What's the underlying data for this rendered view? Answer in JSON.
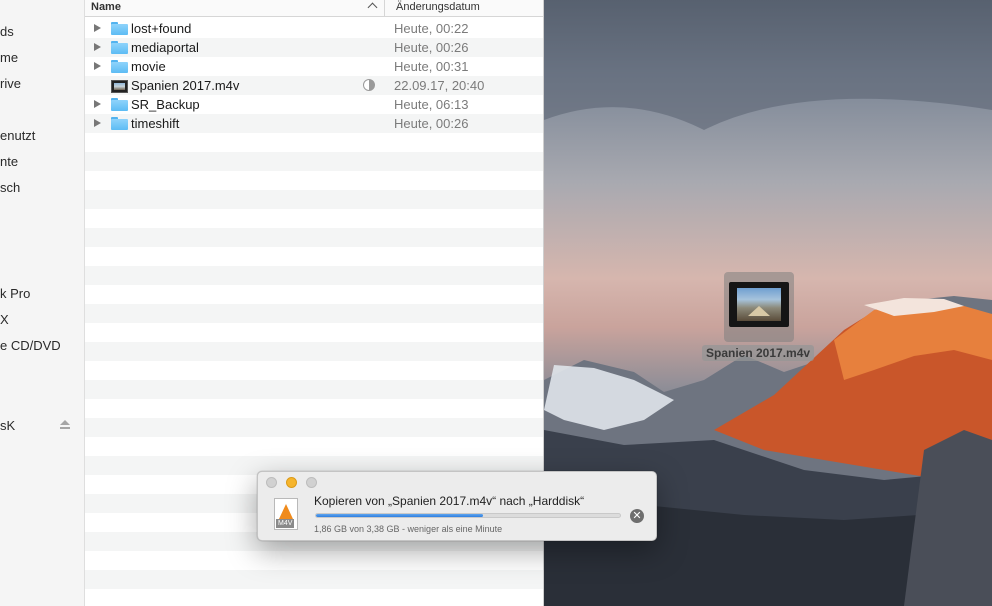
{
  "sidebar": {
    "items": [
      "ds",
      "me",
      "rive",
      "enutzt",
      "nte",
      "sch",
      "k Pro",
      "X",
      "e CD/DVD",
      "sK"
    ]
  },
  "file_list": {
    "columns": {
      "name": "Name",
      "date": "Änderungsdatum"
    },
    "rows": [
      {
        "name": "lost+found",
        "date": "Heute, 00:22",
        "kind": "folder"
      },
      {
        "name": "mediaportal",
        "date": "Heute, 00:26",
        "kind": "folder"
      },
      {
        "name": "movie",
        "date": "Heute, 00:31",
        "kind": "folder"
      },
      {
        "name": "Spanien 2017.m4v",
        "date": "22.09.17, 20:40",
        "kind": "video",
        "status_icon": "half-circle-progress-icon"
      },
      {
        "name": "SR_Backup",
        "date": "Heute, 06:13",
        "kind": "folder"
      },
      {
        "name": "timeshift",
        "date": "Heute, 00:26",
        "kind": "folder"
      }
    ]
  },
  "desktop": {
    "file_label": "Spanien 2017.m4v"
  },
  "copy_dialog": {
    "title": "Kopieren von „Spanien 2017.m4v“ nach „Harddisk“",
    "status": "1,86 GB von 3,38 GB - weniger als eine Minute",
    "progress_fraction": 0.55,
    "file_icon_ext": "M4V",
    "accent": "#2f7fe0"
  }
}
